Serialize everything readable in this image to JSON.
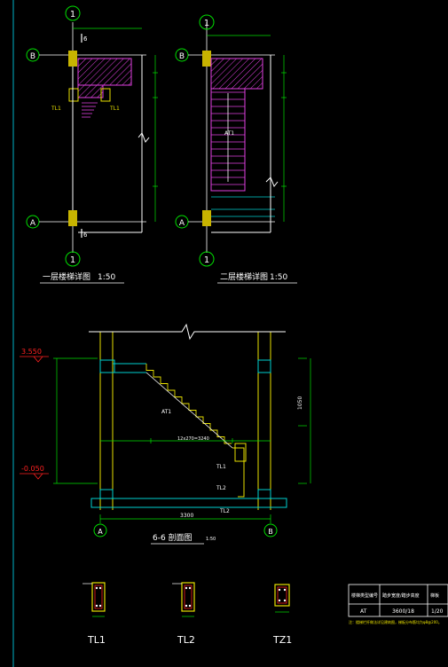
{
  "colors": {
    "background": "#000000",
    "frame": "#00b4c8",
    "structure": "#ffffff",
    "dimension": "#00e000",
    "stair": "#e040e0",
    "elevation": "#ff2020",
    "column_fill": "#c8b400",
    "slab": "#00d0d0",
    "note": "#e8e000"
  },
  "plan1": {
    "title": "一层楼梯详图",
    "scale": "1:50",
    "axis_top": "1",
    "axis_bottom": "1",
    "axis_B": "B",
    "axis_A": "A",
    "section_mark": "6",
    "label_tl1": "TL1",
    "label_tl1b": "TL1"
  },
  "plan2": {
    "title": "二层楼梯详图",
    "scale": "1:50",
    "axis_top": "1",
    "axis_bottom": "1",
    "axis_B": "B",
    "axis_A": "A",
    "label_at": "AT1"
  },
  "section": {
    "title": "6-6 剖面图",
    "scale": "1:50",
    "elev_top": "3.550",
    "elev_bottom": "-0.050",
    "axis_A": "A",
    "axis_B": "B",
    "span": "3300",
    "label_at": "AT1",
    "label_tl1": "TL1",
    "label_tl2": "TL2",
    "label_tl2b": "TL2",
    "dim_mid": "12x270=3240",
    "dim_right": "1050"
  },
  "details": {
    "tl1": "TL1",
    "tl2": "TL2",
    "tz1": "TZ1"
  },
  "table": {
    "headers": [
      "楼梯类型编号",
      "踏步宽度/踏步高度",
      "梯板"
    ],
    "row": [
      "AT",
      "3600/18",
      "1/20"
    ],
    "note": "注：楼梯栏杆做法详见建筑图，梯板分布筋均为φ8@200。"
  }
}
